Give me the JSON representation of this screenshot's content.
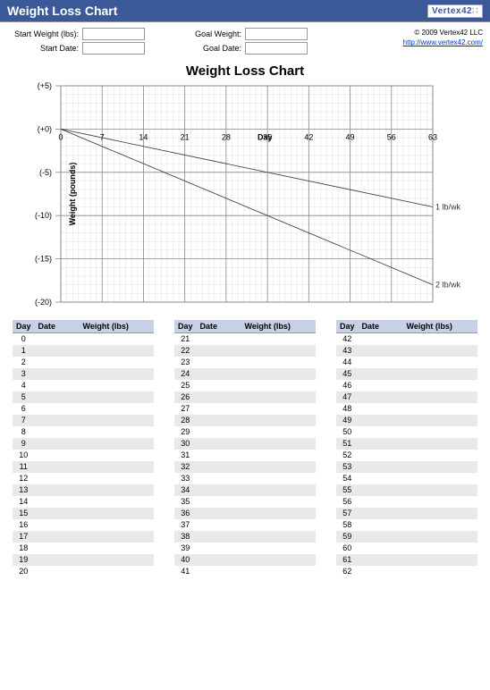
{
  "titlebar": {
    "title": "Weight Loss Chart"
  },
  "logo": {
    "text": "Vertex42",
    "dots": "∷"
  },
  "form": {
    "start_weight_label": "Start Weight (lbs):",
    "start_date_label": "Start Date:",
    "goal_weight_label": "Goal Weight:",
    "goal_date_label": "Goal Date:",
    "start_weight_value": "",
    "start_date_value": "",
    "goal_weight_value": "",
    "goal_date_value": ""
  },
  "credit": {
    "copyright": "© 2009 Vertex42 LLC",
    "link": "http://www.vertex42.com/"
  },
  "chart_data": {
    "type": "line",
    "title": "Weight Loss Chart",
    "xlabel": "Day",
    "ylabel": "Weight (pounds)",
    "xlim": [
      0,
      63
    ],
    "ylim": [
      -20,
      5
    ],
    "x_ticks": [
      0,
      7,
      14,
      21,
      28,
      35,
      42,
      49,
      56,
      63
    ],
    "y_ticks": [
      -20,
      -15,
      -10,
      -5,
      0,
      5
    ],
    "y_tick_labels": [
      "(-20)",
      "(-15)",
      "(-10)",
      "(-5)",
      "(+0)",
      "(+5)"
    ],
    "series": [
      {
        "name": "1 lb/wk",
        "x": [
          0,
          63
        ],
        "y": [
          0,
          -9
        ]
      },
      {
        "name": "2 lb/wk",
        "x": [
          0,
          63
        ],
        "y": [
          0,
          -18
        ]
      }
    ]
  },
  "tables": {
    "headers": {
      "day": "Day",
      "date": "Date",
      "weight": "Weight (lbs)"
    },
    "columns": [
      {
        "days": [
          0,
          1,
          2,
          3,
          4,
          5,
          6,
          7,
          8,
          9,
          10,
          11,
          12,
          13,
          14,
          15,
          16,
          17,
          18,
          19,
          20
        ]
      },
      {
        "days": [
          21,
          22,
          23,
          24,
          25,
          26,
          27,
          28,
          29,
          30,
          31,
          32,
          33,
          34,
          35,
          36,
          37,
          38,
          39,
          40,
          41
        ]
      },
      {
        "days": [
          42,
          43,
          44,
          45,
          46,
          47,
          48,
          49,
          50,
          51,
          52,
          53,
          54,
          55,
          56,
          57,
          58,
          59,
          60,
          61,
          62
        ]
      }
    ]
  }
}
